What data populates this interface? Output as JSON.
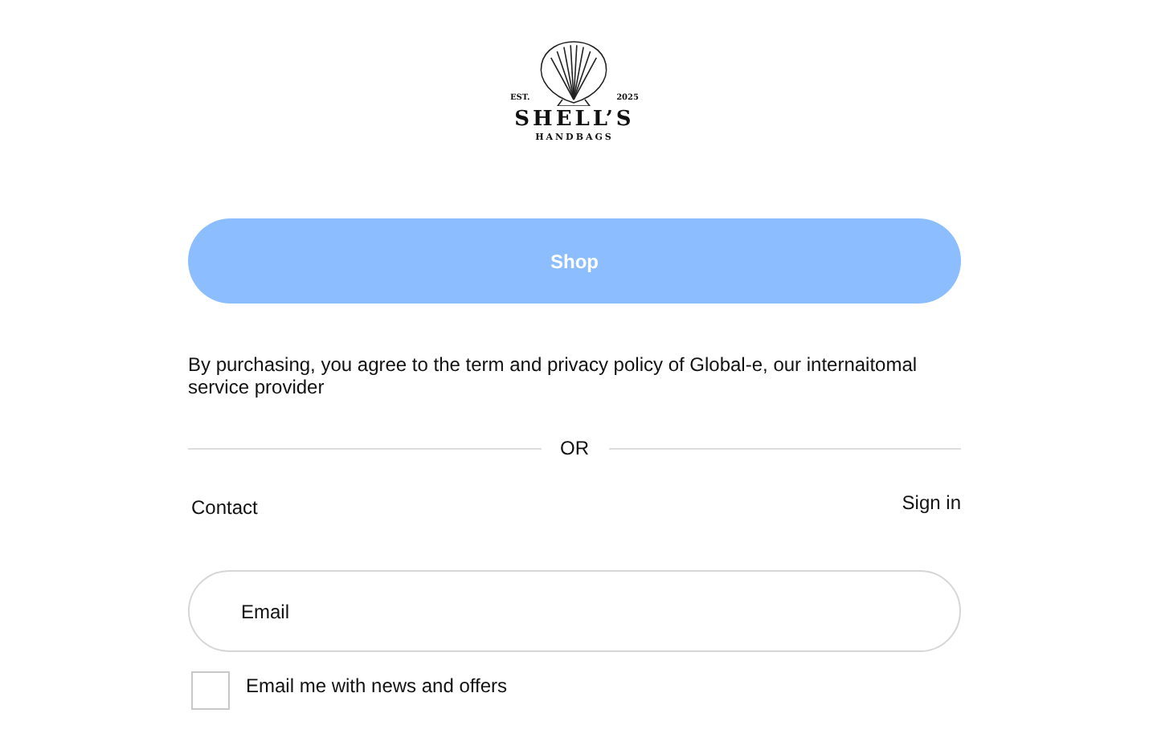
{
  "logo": {
    "est": "EST.",
    "year": "2025",
    "name": "SHELL’S",
    "tagline": "HANDBAGS"
  },
  "shop_button": {
    "label": "Shop"
  },
  "notice": "By purchasing, you agree to the term and privacy policy of Global-e, our internaitomal service provider",
  "divider": {
    "label": "OR"
  },
  "contact": {
    "title": "Contact",
    "sign_in": "Sign in"
  },
  "email_field": {
    "placeholder": "Email"
  },
  "newsletter": {
    "label": "Email me with news and offers",
    "checked": false
  }
}
